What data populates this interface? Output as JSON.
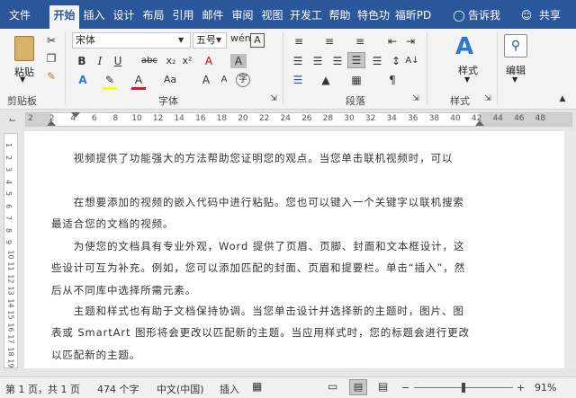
{
  "tabs": [
    {
      "label": "文件"
    },
    {
      "label": "开始"
    },
    {
      "label": "插入"
    },
    {
      "label": "设计"
    },
    {
      "label": "布局"
    },
    {
      "label": "引用"
    },
    {
      "label": "邮件"
    },
    {
      "label": "审阅"
    },
    {
      "label": "视图"
    },
    {
      "label": "开发工"
    },
    {
      "label": "帮助"
    },
    {
      "label": "特色功"
    },
    {
      "label": "福昕PD"
    }
  ],
  "tell_me": "告诉我",
  "share": "共享",
  "clipboard": {
    "paste": "粘贴",
    "group": "剪贴板"
  },
  "font": {
    "name": "宋体",
    "size": "五号",
    "group": "字体",
    "wen_icon": "wén-icon",
    "a_box": "A"
  },
  "paragraph": {
    "group": "段落"
  },
  "styles": {
    "label": "样式",
    "group": "样式"
  },
  "editing": {
    "label": "编辑"
  },
  "ruler_numbers": [
    "2",
    "2",
    "4",
    "6",
    "8",
    "10",
    "12",
    "14",
    "16",
    "18",
    "20",
    "22",
    "24",
    "26",
    "28",
    "30",
    "32",
    "34",
    "36",
    "38",
    "40",
    "42",
    "44",
    "46",
    "48"
  ],
  "vruler_numbers": [
    "1",
    "2",
    "3",
    "4",
    "5",
    "6",
    "7",
    "8",
    "9",
    "10",
    "11",
    "12",
    "13",
    "14",
    "15",
    "16",
    "17",
    "18",
    "19"
  ],
  "document": {
    "paragraphs": [
      "　　视频提供了功能强大的方法帮助您证明您的观点。当您单击联机视频时，可以",
      "　　在想要添加的视频的嵌入代码中进行粘贴。您也可以键入一个关键字以联机搜索最适合您的文档的视频。",
      "　　为使您的文档具有专业外观，Word 提供了页眉、页脚、封面和文本框设计，这些设计可互为补充。例如，您可以添加匹配的封面、页眉和提要栏。单击“插入”，然后从不同库中选择所需元素。",
      "　　主题和样式也有助于文档保持协调。当您单击设计并选择新的主题时，图片、图表或 SmartArt 图形将会更改以匹配新的主题。当应用样式时，您的标题会进行更改以匹配新的主题。"
    ]
  },
  "status": {
    "page": "第 1 页，共 1 页",
    "words": "474 个字",
    "language": "中文(中国)",
    "mode": "插入",
    "zoom": "91%"
  },
  "colors": {
    "accent": "#2b579a",
    "highlight": "#ffff00",
    "font_red": "#e81123"
  }
}
